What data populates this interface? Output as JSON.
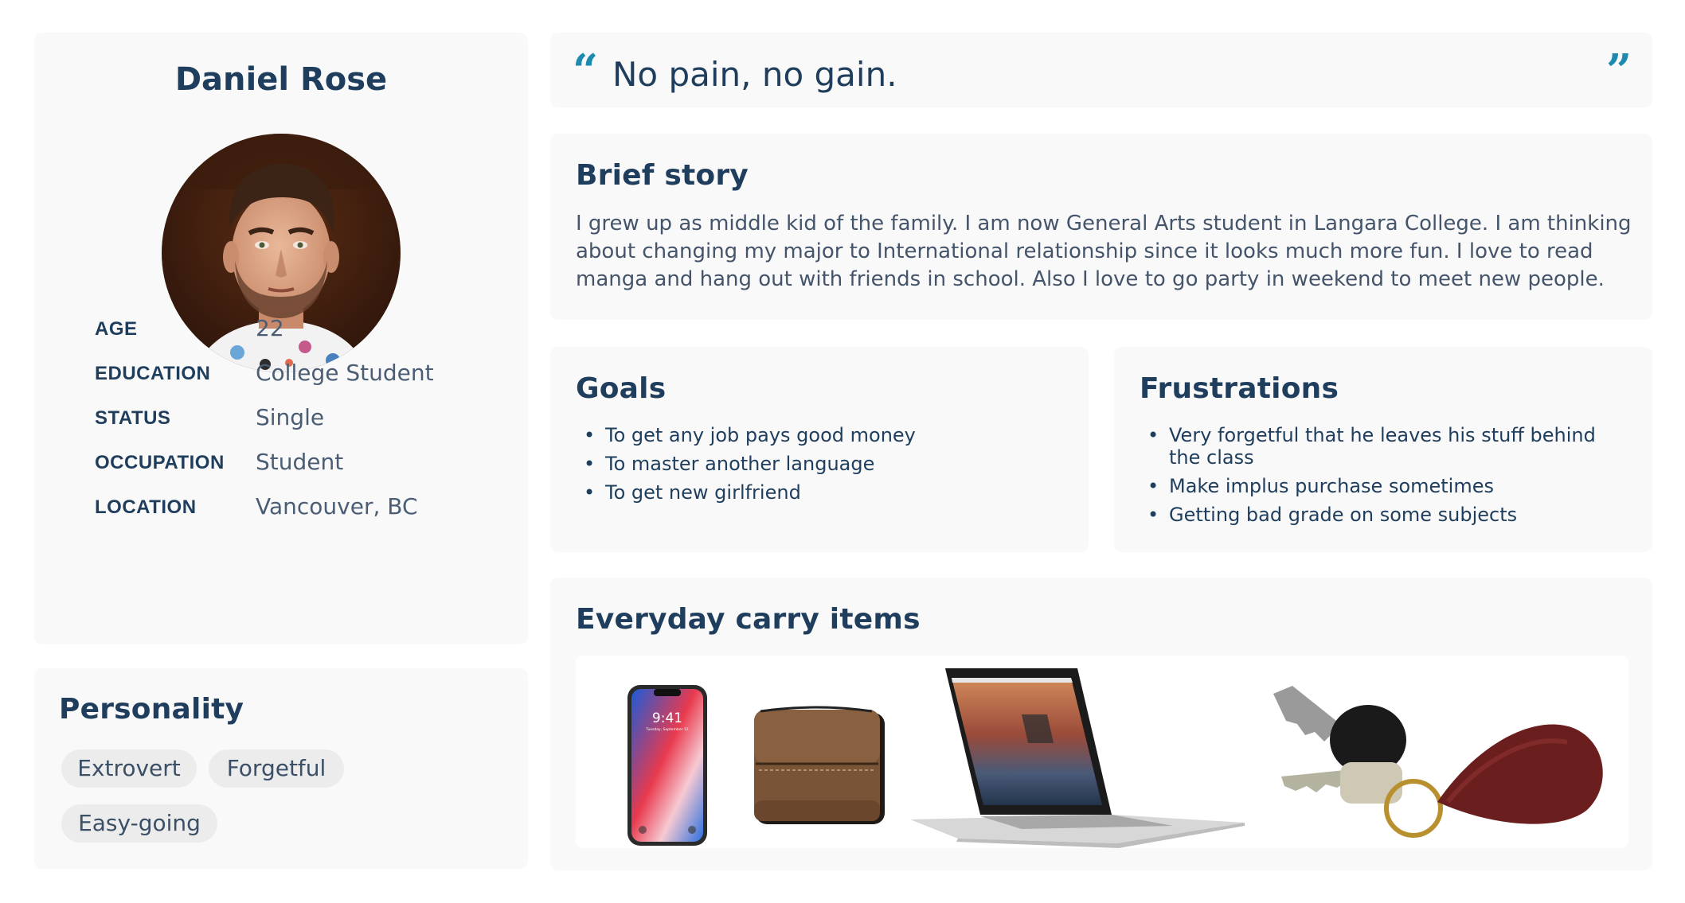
{
  "profile": {
    "name": "Daniel Rose",
    "avatar_icon": "person-photo",
    "info": [
      {
        "label": "AGE",
        "value": "22"
      },
      {
        "label": "EDUCATION",
        "value": "College Student"
      },
      {
        "label": "STATUS",
        "value": "Single"
      },
      {
        "label": "OCCUPATION",
        "value": "Student"
      },
      {
        "label": "LOCATION",
        "value": "Vancouver, BC"
      }
    ]
  },
  "personality": {
    "title": "Personality",
    "traits": [
      "Extrovert",
      "Forgetful",
      "Easy-going"
    ]
  },
  "quote": {
    "open_mark": "“",
    "close_mark": "”",
    "text": "No pain, no gain."
  },
  "story": {
    "title": "Brief story",
    "text": "I grew up as middle kid of the family. I am now  General Arts student in Langara College. I am thinking about changing my major to International relationship since it looks much more fun. I love to read manga and hang out with friends in school. Also I love to go party in weekend to meet new people."
  },
  "goals": {
    "title": "Goals",
    "items": [
      "To get any job pays good money",
      "To master another language",
      "To get new girlfriend"
    ]
  },
  "frustrations": {
    "title": "Frustrations",
    "items": [
      "Very forgetful that he leaves his stuff behind the class",
      "Make implus purchase sometimes",
      "Getting bad grade on some subjects"
    ]
  },
  "carry": {
    "title": "Everyday carry items",
    "items": [
      {
        "name": "smartphone",
        "icon": "phone-icon",
        "screen_time": "9:41",
        "screen_date": "Tuesday, September 12"
      },
      {
        "name": "wallet",
        "icon": "wallet-icon"
      },
      {
        "name": "laptop",
        "icon": "laptop-icon"
      },
      {
        "name": "keys",
        "icon": "keys-icon"
      }
    ]
  },
  "colors": {
    "heading": "#1f3d5c",
    "body": "#44546a",
    "card_bg": "#f9f9f9",
    "quote_accent": "#1f8ab0",
    "pill_bg": "#ececec"
  }
}
